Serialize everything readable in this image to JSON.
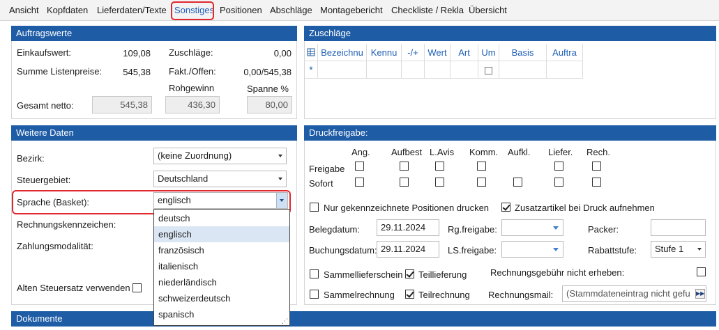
{
  "tabs": [
    {
      "label": "Ansicht"
    },
    {
      "label": "Kopfdaten"
    },
    {
      "label": "Lieferdaten/Texte"
    },
    {
      "label": "Sonstiges"
    },
    {
      "label": "Positionen"
    },
    {
      "label": "Abschläge"
    },
    {
      "label": "Montagebericht"
    },
    {
      "label": "Checkliste / Rekla"
    },
    {
      "label": "Übersicht"
    }
  ],
  "auftragswerte": {
    "title": "Auftragswerte",
    "einkaufswert_label": "Einkaufswert:",
    "einkaufswert": "109,08",
    "zuschlaege_label": "Zuschläge:",
    "zuschlaege": "0,00",
    "summe_label": "Summe Listenpreise:",
    "summe": "545,38",
    "fakt_label": "Fakt./Offen:",
    "fakt": "0,00/545,38",
    "rohgewinn_label": "Rohgewinn",
    "spanne_label": "Spanne %",
    "gesamt_label": "Gesamt netto:",
    "gesamt": "545,38",
    "rohgewinn": "436,30",
    "spanne": "80,00"
  },
  "zuschlaege_panel": {
    "title": "Zuschläge",
    "columns": [
      "Bezeichnu",
      "Kennu",
      "-/+",
      "Wert",
      "Art",
      "Um",
      "Basis",
      "Auftra"
    ],
    "new_row_marker": "*"
  },
  "weitere": {
    "title": "Weitere Daten",
    "bezirk_label": "Bezirk:",
    "bezirk": "(keine Zuordnung)",
    "steuer_label": "Steuergebiet:",
    "steuer": "Deutschland",
    "sprache_label": "Sprache (Basket):",
    "sprache": "englisch",
    "rechnung_label": "Rechnungskennzeichen:",
    "zahlung_label": "Zahlungsmodalität:",
    "alten_label": "Alten Steuersatz verwenden",
    "sprache_options": [
      "deutsch",
      "englisch",
      "französisch",
      "italienisch",
      "niederländisch",
      "schweizerdeutsch",
      "spanisch"
    ]
  },
  "druck": {
    "title": "Druckfreigabe:",
    "cols": [
      "Ang.",
      "Aufbest",
      "L.Avis",
      "Komm.",
      "Aufkl.",
      "Liefer.",
      "Rech."
    ],
    "freigabe_label": "Freigabe",
    "sofort_label": "Sofort",
    "nur_label": "Nur gekennzeichnete Positionen drucken",
    "zusatz_label": "Zusatzartikel bei Druck aufnehmen",
    "belegdatum_label": "Belegdatum:",
    "belegdatum": "29.11.2024",
    "buchungsdatum_label": "Buchungsdatum:",
    "buchungsdatum": "29.11.2024",
    "rgfreigabe_label": "Rg.freigabe:",
    "lsfreigabe_label": "LS.freigabe:",
    "packer_label": "Packer:",
    "rabatt_label": "Rabattstufe:",
    "rabatt": "Stufe 1",
    "sammelliefer_label": "Sammellieferschein",
    "teillieferung_label": "Teillieferung",
    "sammelrech_label": "Sammelrechnung",
    "teilrech_label": "Teilrechnung",
    "gebuehr_label": "Rechnungsgebühr nicht erheben:",
    "mail_label": "Rechnungsmail:",
    "mail": "(Stammdateneintrag nicht gefu"
  },
  "dokumente": {
    "title": "Dokumente"
  }
}
